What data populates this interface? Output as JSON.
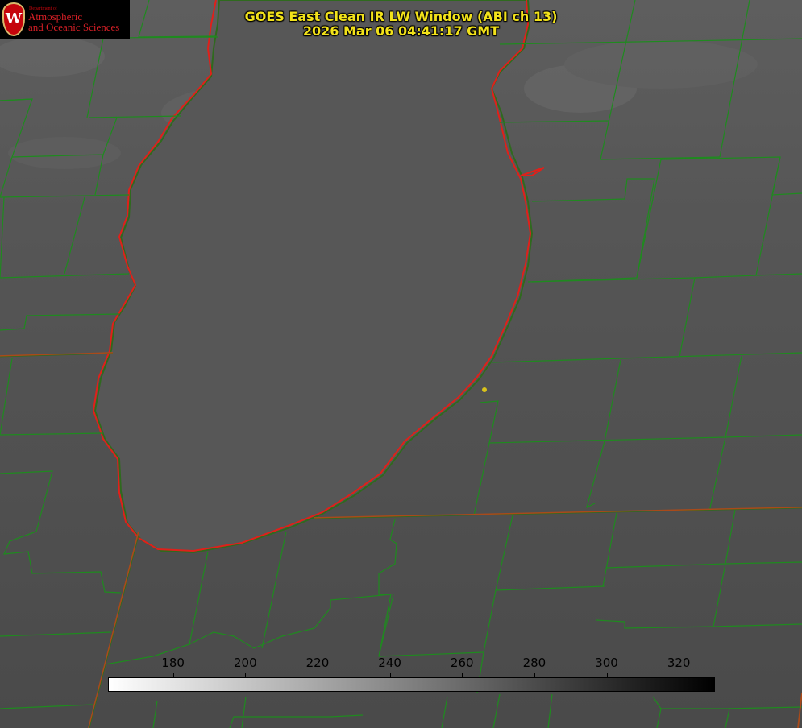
{
  "title": {
    "line1": "GOES East Clean IR LW Window (ABI ch 13)",
    "line2": "2026 Mar 06 04:41:17 GMT"
  },
  "logo": {
    "department": "Department of",
    "line1": "Atmospheric",
    "line2": "and Oceanic Sciences",
    "shield_letter": "W"
  },
  "colorbar": {
    "ticks": [
      "180",
      "200",
      "220",
      "240",
      "260",
      "280",
      "300",
      "320"
    ],
    "range": [
      162,
      330
    ],
    "gradient": [
      "#ffffff",
      "#000000"
    ]
  },
  "colors": {
    "land": "#4f4f4f",
    "lake": "#575757",
    "county_lines": "#1f8a1f",
    "coast_outline": "#e0201a",
    "state_line": "#a94a1a",
    "marker": "#d9c21a",
    "title": "#f2e21a"
  }
}
